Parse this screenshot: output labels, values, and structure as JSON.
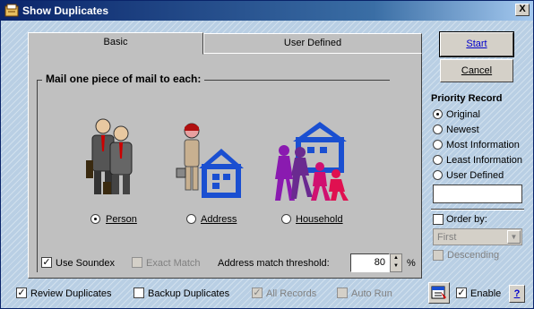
{
  "window": {
    "title": "Show Duplicates",
    "close_symbol": "X"
  },
  "tabs": [
    {
      "label": "Basic",
      "active": true
    },
    {
      "label": "User Defined",
      "active": false
    }
  ],
  "group": {
    "title": "Mail one piece of mail to each:",
    "options": [
      {
        "label": "Person",
        "selected": true,
        "icon": "person-icon"
      },
      {
        "label": "Address",
        "selected": false,
        "icon": "house-icon"
      },
      {
        "label": "Household",
        "selected": false,
        "icon": "household-icon"
      }
    ]
  },
  "use_soundex": {
    "label": "Use Soundex",
    "checked": true
  },
  "exact_match": {
    "label": "Exact Match",
    "checked": false,
    "disabled": true
  },
  "threshold": {
    "label": "Address match threshold:",
    "value": "80",
    "unit": "%"
  },
  "buttons": {
    "start": "Start",
    "cancel": "Cancel",
    "help": "?"
  },
  "priority": {
    "title": "Priority Record",
    "options": [
      {
        "label": "Original",
        "selected": true
      },
      {
        "label": "Newest",
        "selected": false
      },
      {
        "label": "Most Information",
        "selected": false
      },
      {
        "label": "Least Information",
        "selected": false
      },
      {
        "label": "User Defined",
        "selected": false
      }
    ],
    "user_defined_value": ""
  },
  "order_by": {
    "label": "Order by:",
    "checked": false,
    "selected": "First"
  },
  "descending": {
    "label": "Descending",
    "checked": false
  },
  "bottom": {
    "review": {
      "label": "Review Duplicates",
      "checked": true
    },
    "backup": {
      "label": "Backup Duplicates",
      "checked": false
    },
    "all_records": {
      "label": "All Records",
      "checked": true,
      "disabled": true
    },
    "auto_run": {
      "label": "Auto Run",
      "checked": false,
      "disabled": true
    },
    "enable": {
      "label": "Enable",
      "checked": true
    }
  },
  "colors": {
    "titlebar": "#0a246a",
    "house": "#1a4fd1",
    "household": "#8a1ab0",
    "link": "#0000cc"
  }
}
